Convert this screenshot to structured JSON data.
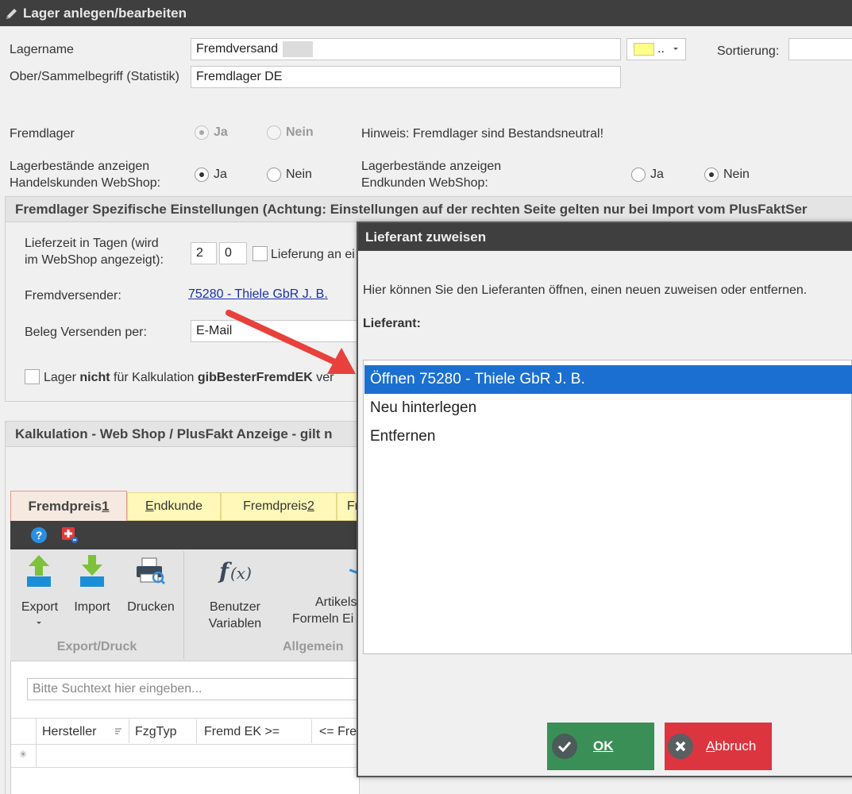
{
  "window": {
    "title": "Lager anlegen/bearbeiten"
  },
  "form": {
    "lagername_label": "Lagername",
    "lagername_value": "Fremdversand",
    "color_dots": "..",
    "sortierung_label": "Sortierung:",
    "ober_label": "Ober/Sammelbegriff (Statistik)",
    "ober_value": "Fremdlager DE",
    "fremdlager_label": "Fremdlager",
    "ja": "Ja",
    "nein": "Nein",
    "hinweis": "Hinweis: Fremdlager sind Bestandsneutral!",
    "handel_label_1": "Lagerbestände anzeigen",
    "handel_label_2": "Handelskunden WebShop:",
    "end_label_1": "Lagerbestände anzeigen",
    "end_label_2": "Endkunden WebShop:"
  },
  "fremdlager_group": {
    "title": "Fremdlager Spezifische Einstellungen (Achtung: Einstellungen auf der rechten Seite gelten nur bei Import vom PlusFaktSer",
    "lieferzeit_label_1": "Lieferzeit in Tagen (wird",
    "lieferzeit_label_2": "im WebShop angezeigt):",
    "lieferzeit_min": "2",
    "lieferzeit_max": "0",
    "lieferung_label": "Lieferung an ei",
    "fremdversender_label": "Fremdversender:",
    "fremdversender_link": "75280 - Thiele GbR J. B.",
    "beleg_label": "Beleg Versenden per:",
    "beleg_value": "E-Mail",
    "kalk_prefix": "Lager ",
    "kalk_bold1": "nicht",
    "kalk_mid": " für Kalkulation ",
    "kalk_bold2": "gibBesterFremdEK",
    "kalk_suffix": " ver"
  },
  "kalk_group": {
    "title": "Kalkulation - Web Shop / PlusFakt Anzeige - gilt n"
  },
  "tabs": {
    "t1_text": "Fremdpreis ",
    "t1_key": "1",
    "t2_key": "E",
    "t2_text": "ndkunde",
    "t3_text": "Fremdpreis ",
    "t3_key": "2",
    "t4_text": "Fr"
  },
  "ribbon": {
    "export": "Export",
    "import": "Import",
    "drucken": "Drucken",
    "benutzer_1": "Benutzer",
    "benutzer_2": "Variablen",
    "artikel_1": "Artikels",
    "artikel_2": "Formeln Ei",
    "group_export": "Export/Druck",
    "group_allgemein": "Allgemein"
  },
  "grid": {
    "search_placeholder": "Bitte Suchtext hier eingeben...",
    "columns": [
      "Hersteller",
      "FzgTyp",
      "Fremd EK >=",
      "<= Fre"
    ],
    "new_row_marker": "✳"
  },
  "dialog": {
    "title": "Lieferant zuweisen",
    "hint": "Hier können Sie den Lieferanten öffnen, einen neuen zuweisen oder entfernen.",
    "lieferant_label": "Lieferant:",
    "items": [
      "Öffnen 75280 - Thiele GbR J. B.",
      "Neu hinterlegen",
      "Entfernen"
    ],
    "ok_label": "OK",
    "abbruch_key": "A",
    "abbruch_rest": "bbruch"
  },
  "colors": {
    "selection": "#1b6fd1",
    "ok_button": "#3a8f56",
    "abbruch_button": "#dc3540",
    "arrow": "#e8413c",
    "tab_yellow": "#fff8b8"
  }
}
